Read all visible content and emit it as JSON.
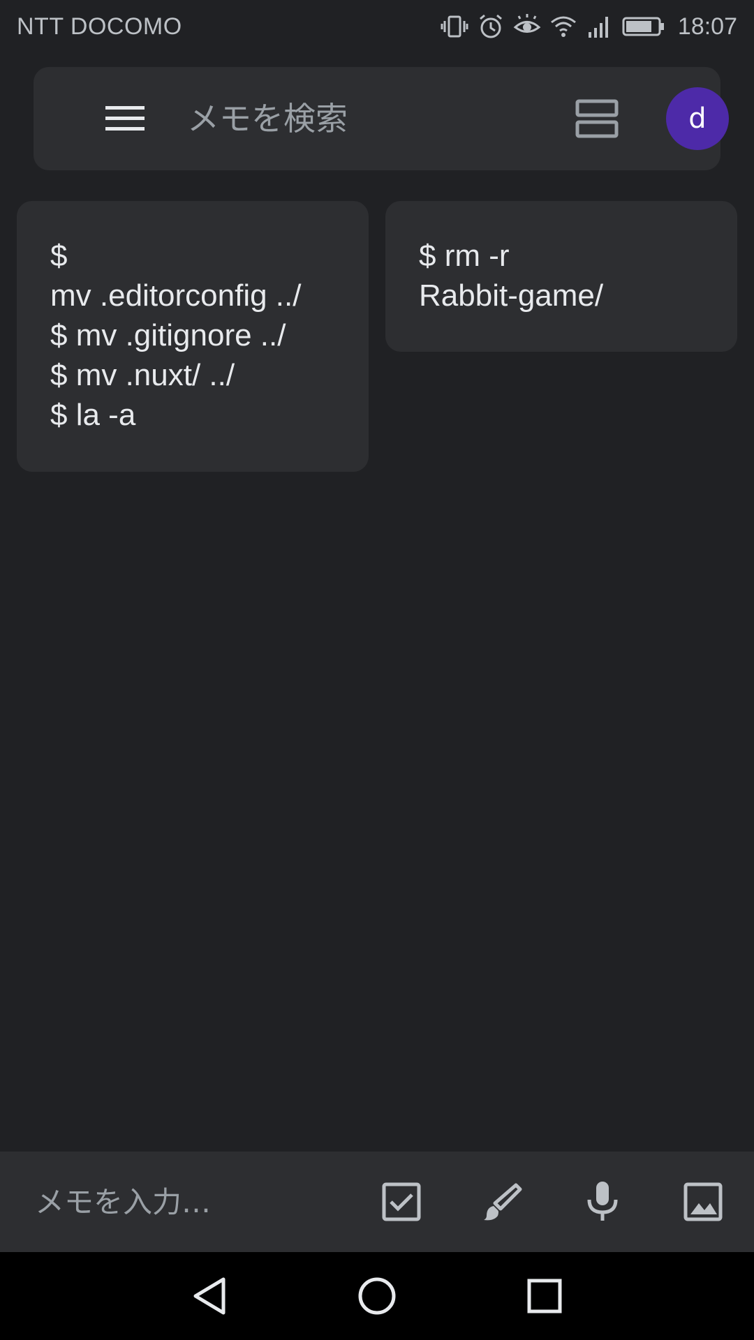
{
  "status_bar": {
    "carrier": "NTT DOCOMO",
    "time": "18:07",
    "icons": [
      "vibrate-icon",
      "alarm-icon",
      "eye-comfort-icon",
      "wifi-icon",
      "signal-icon",
      "battery-icon"
    ]
  },
  "search": {
    "placeholder": "メモを検索",
    "menu_icon": "hamburger-menu-icon",
    "layout_icon": "list-view-icon",
    "avatar_initial": "d",
    "avatar_color": "#4d2aa8"
  },
  "notes": [
    {
      "text": "$\nmv .editorconfig ../\n$ mv .gitignore ../\n$ mv .nuxt/ ../\n$ la -a"
    },
    {
      "text": "$ rm -r\nRabbit-game/"
    }
  ],
  "bottom_bar": {
    "placeholder": "メモを入力…",
    "icons": [
      "checkbox-icon",
      "brush-icon",
      "mic-icon",
      "image-icon"
    ]
  },
  "nav_bar": {
    "icons": [
      "back-icon",
      "home-icon",
      "recents-icon"
    ]
  },
  "colors": {
    "background": "#202124",
    "surface": "#2d2e31",
    "text": "#e8eaed",
    "muted": "#9aa0a6"
  }
}
